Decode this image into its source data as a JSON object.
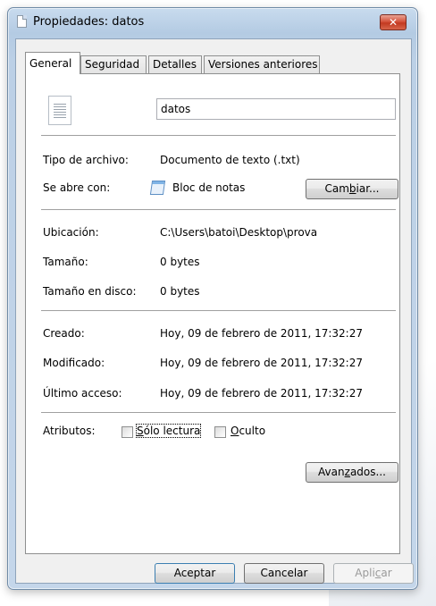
{
  "window": {
    "title": "Propiedades: datos",
    "close_label": "✕"
  },
  "tabs": [
    {
      "label": "General"
    },
    {
      "label": "Seguridad"
    },
    {
      "label": "Detalles"
    },
    {
      "label": "Versiones anteriores"
    }
  ],
  "general": {
    "file_name": "datos",
    "file_type_label": "Tipo de archivo:",
    "file_type_value": "Documento de texto (.txt)",
    "opens_with_label": "Se abre con:",
    "opens_with_value": "Bloc de notas",
    "change_button": {
      "pre": "Cam",
      "u": "b",
      "post": "iar..."
    },
    "location_label": "Ubicación:",
    "location_value": "C:\\Users\\batoi\\Desktop\\prova",
    "size_label": "Tamaño:",
    "size_value": "0 bytes",
    "size_on_disk_label": "Tamaño en disco:",
    "size_on_disk_value": "0 bytes",
    "created_label": "Creado:",
    "created_value": "Hoy, 09 de febrero de 2011, 17:32:27",
    "modified_label": "Modificado:",
    "modified_value": "Hoy, 09 de febrero de 2011, 17:32:27",
    "accessed_label": "Último acceso:",
    "accessed_value": "Hoy, 09 de febrero de 2011, 17:32:27",
    "attributes_label": "Atributos:",
    "readonly": {
      "pre": "",
      "u": "S",
      "post": "ólo lectura",
      "checked": false
    },
    "hidden": {
      "pre": "",
      "u": "O",
      "post": "culto",
      "checked": false
    },
    "advanced_button": {
      "pre": "Avan",
      "u": "z",
      "post": "ados..."
    }
  },
  "footer": {
    "accept": "Aceptar",
    "cancel": "Cancelar",
    "apply": {
      "pre": "Apli",
      "u": "c",
      "post": "ar"
    }
  },
  "icons": [
    "document-icon",
    "close-icon",
    "text-file-icon",
    "notepad-icon",
    "checkbox-icon"
  ]
}
